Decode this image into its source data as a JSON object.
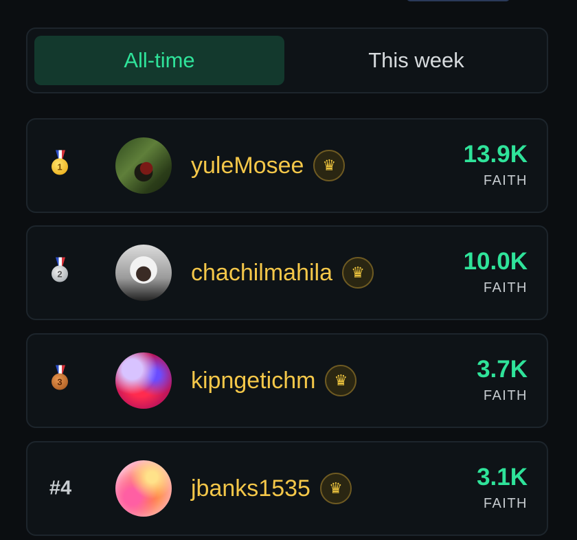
{
  "tabs": [
    {
      "label": "All-time",
      "active": true
    },
    {
      "label": "This week",
      "active": false
    }
  ],
  "colors": {
    "background": "#0b0e11",
    "card": "#0e1317",
    "accent_green": "#2fe39a",
    "username_gold": "#f4c749",
    "active_tab_bg": "#13392d"
  },
  "leaderboard": [
    {
      "rank_icon": "gold-medal-icon",
      "medal_number": "1",
      "username": "yuleMosee",
      "badge_icon": "crown-icon",
      "score": "13.9K",
      "unit": "FAITH"
    },
    {
      "rank_icon": "silver-medal-icon",
      "medal_number": "2",
      "username": "chachilmahila",
      "badge_icon": "crown-icon",
      "score": "10.0K",
      "unit": "FAITH"
    },
    {
      "rank_icon": "bronze-medal-icon",
      "medal_number": "3",
      "username": "kipngetichm",
      "badge_icon": "crown-icon",
      "score": "3.7K",
      "unit": "FAITH"
    },
    {
      "rank_label": "#4",
      "username": "jbanks1535",
      "badge_icon": "crown-icon",
      "score": "3.1K",
      "unit": "FAITH"
    }
  ],
  "icons": {
    "crown": "♛"
  }
}
